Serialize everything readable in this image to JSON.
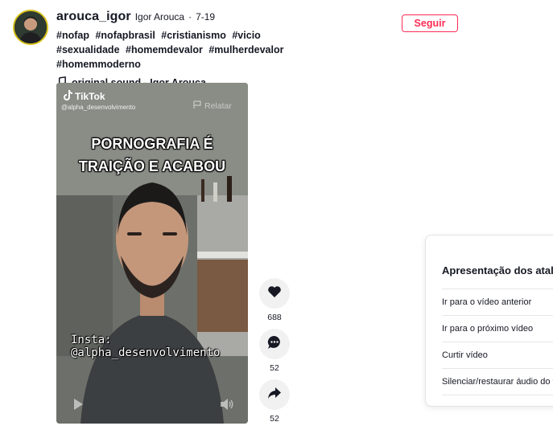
{
  "post": {
    "username": "arouca_igor",
    "nickname": "Igor Arouca",
    "separator": "·",
    "date": "7-19",
    "hashtags": [
      "#nofap",
      "#nofapbrasil",
      "#cristianismo",
      "#vicio",
      "#sexualidade",
      "#homemdevalor",
      "#mulherdevalor",
      "#homemmoderno"
    ],
    "sound": "original sound - Igor Arouca",
    "follow_label": "Seguir"
  },
  "video": {
    "watermark_brand": "TikTok",
    "watermark_handle": "@alpha_desenvolvimento",
    "report_label": "Relatar",
    "overlay_line1": "PORNOGRAFIA É",
    "overlay_line2": "TRAIÇÃO E ACABOU",
    "insta_text": "Insta: @alpha_desenvolvimento"
  },
  "actions": {
    "likes": "688",
    "comments": "52",
    "shares": "52"
  },
  "keyboard_panel": {
    "title": "Apresentação dos atalhos de teclado",
    "items": [
      "Ir para o vídeo anterior",
      "Ir para o próximo vídeo",
      "Curtir vídeo",
      "Silenciar/restaurar áudio do vídeo"
    ]
  },
  "colors": {
    "accent": "#fe2c55",
    "avatar_ring": "#d8c21a",
    "action_bg": "#f1f1f2"
  }
}
